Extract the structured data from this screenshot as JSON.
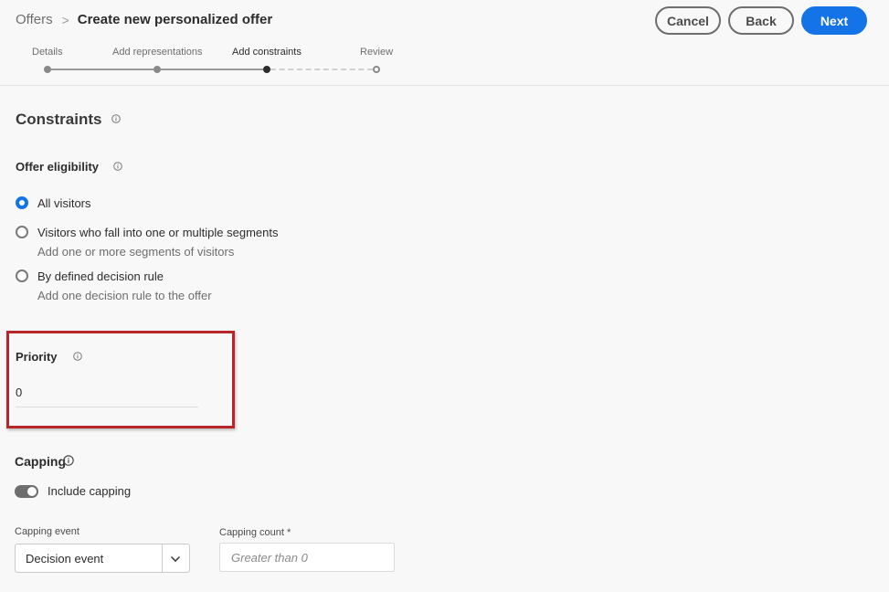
{
  "breadcrumb": {
    "parent": "Offers",
    "separator": ">",
    "title": "Create new personalized offer"
  },
  "buttons": {
    "cancel": "Cancel",
    "back": "Back",
    "next": "Next"
  },
  "steps": [
    "Details",
    "Add representations",
    "Add constraints",
    "Review"
  ],
  "current_step": "Add constraints",
  "constraints": {
    "title": "Constraints"
  },
  "eligibility": {
    "title": "Offer eligibility",
    "options": [
      {
        "label": "All visitors",
        "description": "",
        "selected": true
      },
      {
        "label": "Visitors who fall into one or multiple segments",
        "description": "Add one or more segments of visitors",
        "selected": false
      },
      {
        "label": "By defined decision rule",
        "description": "Add one decision rule to the offer",
        "selected": false
      }
    ]
  },
  "priority": {
    "title": "Priority",
    "value": "0"
  },
  "capping": {
    "title": "Capping",
    "toggle_label": "Include capping",
    "toggle_on": true,
    "event_label": "Capping event",
    "event_value": "Decision event",
    "count_label": "Capping count",
    "required_mark": "*",
    "count_placeholder": "Greater than 0"
  },
  "colors": {
    "accent": "#1473e6",
    "highlight": "#b8262a"
  },
  "icons": [
    "info-icon",
    "chevron-down-icon"
  ]
}
